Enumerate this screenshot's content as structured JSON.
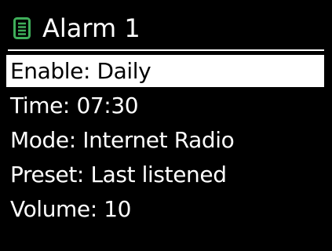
{
  "header": {
    "icon": "alarm-list-icon",
    "title": "Alarm 1"
  },
  "menu": {
    "items": [
      {
        "label": "Enable: Daily",
        "selected": true
      },
      {
        "label": "Time: 07:30",
        "selected": false
      },
      {
        "label": "Mode: Internet Radio",
        "selected": false
      },
      {
        "label": "Preset: Last listened",
        "selected": false
      },
      {
        "label": "Volume: 10",
        "selected": false
      }
    ]
  },
  "colors": {
    "background": "#000000",
    "foreground": "#ffffff",
    "icon_accent": "#3fae5a"
  }
}
